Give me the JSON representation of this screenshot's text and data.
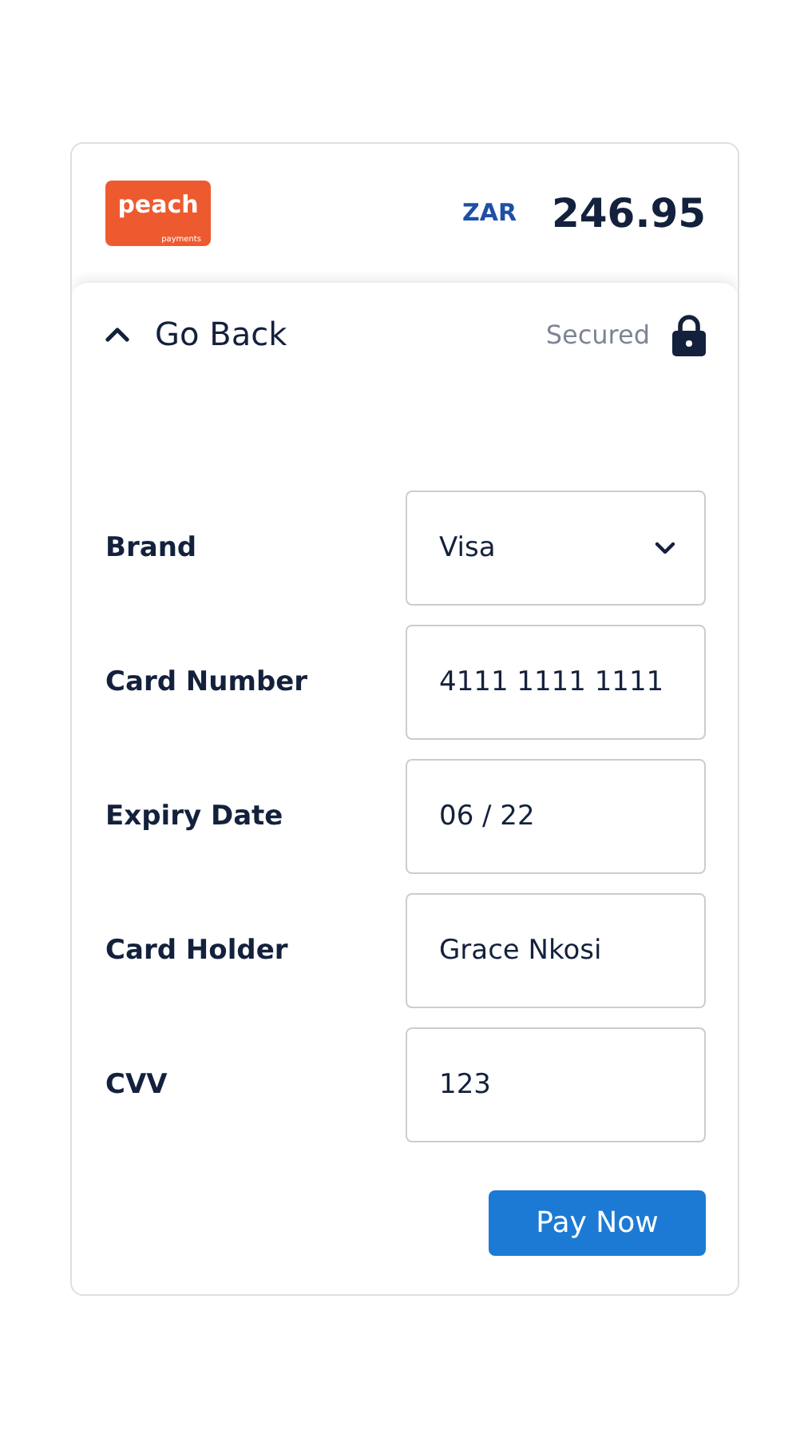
{
  "logo": {
    "name": "peach",
    "tagline": "payments"
  },
  "amount": {
    "currency": "ZAR",
    "value": "246.95"
  },
  "nav": {
    "back": "Go Back",
    "secured": "Secured"
  },
  "fields": [
    {
      "label": "Brand",
      "kind": "select",
      "value": "Visa"
    },
    {
      "label": "Card Number",
      "kind": "input",
      "value": "4111 1111 1111"
    },
    {
      "label": "Expiry Date",
      "kind": "input",
      "value": "06 / 22"
    },
    {
      "label": "Card Holder",
      "kind": "input",
      "value": "Grace Nkosi"
    },
    {
      "label": "CVV",
      "kind": "input",
      "value": "123"
    }
  ],
  "submit": "Pay Now"
}
